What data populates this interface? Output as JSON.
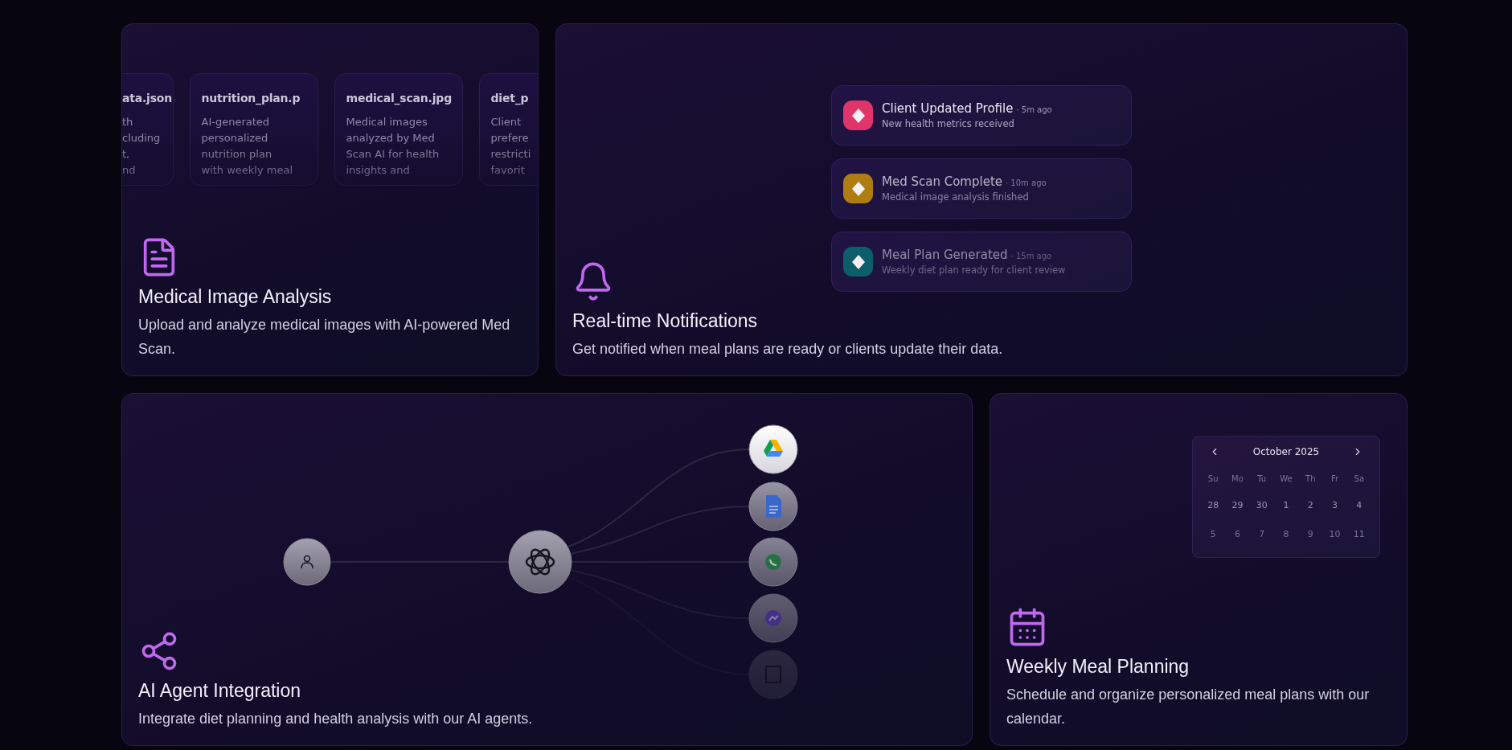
{
  "cards": [
    {
      "kind": "files",
      "title": "Medical Image Analysis",
      "description": "Upload and analyze medical images with AI-powered Med Scan.",
      "files": [
        {
          "name": "ata.json",
          "description": "th\ncluding\nt,\nnd"
        },
        {
          "name": "nutrition_plan.p",
          "description": "AI-generated\npersonalized\nnutrition plan\nwith weekly meal"
        },
        {
          "name": "medical_scan.jpg",
          "description": "Medical images\nanalyzed by Med\nScan AI for health\ninsights and"
        },
        {
          "name": "diet_p",
          "description": "Client\nprefere\nrestricti\nfavorit"
        }
      ]
    },
    {
      "kind": "notifications",
      "title": "Real-time Notifications",
      "description": "Get notified when meal plans are ready or clients update their data.",
      "notifications": [
        {
          "title": "Client Updated Profile",
          "time": "· 5m ago",
          "message": "New health metrics received",
          "color": "#e0356a"
        },
        {
          "title": "Med Scan Complete",
          "time": "· 10m ago",
          "message": "Medical image analysis finished",
          "color": "#b07d12"
        },
        {
          "title": "Meal Plan Generated",
          "time": "· 15m ago",
          "message": "Weekly diet plan ready for client review",
          "color": "#0e5d6b"
        }
      ]
    },
    {
      "kind": "agents",
      "title": "AI Agent Integration",
      "description": "Integrate diet planning and health analysis with our AI agents."
    },
    {
      "kind": "calendar",
      "title": "Weekly Meal Planning",
      "description": "Schedule and organize personalized meal plans with our calendar.",
      "calendar": {
        "month": "October 2025",
        "weekdays": [
          "Su",
          "Mo",
          "Tu",
          "We",
          "Th",
          "Fr",
          "Sa"
        ],
        "weeks": [
          [
            "28",
            "29",
            "30",
            "1",
            "2",
            "3",
            "4"
          ],
          [
            "5",
            "6",
            "7",
            "8",
            "9",
            "10",
            "11"
          ]
        ]
      }
    }
  ]
}
